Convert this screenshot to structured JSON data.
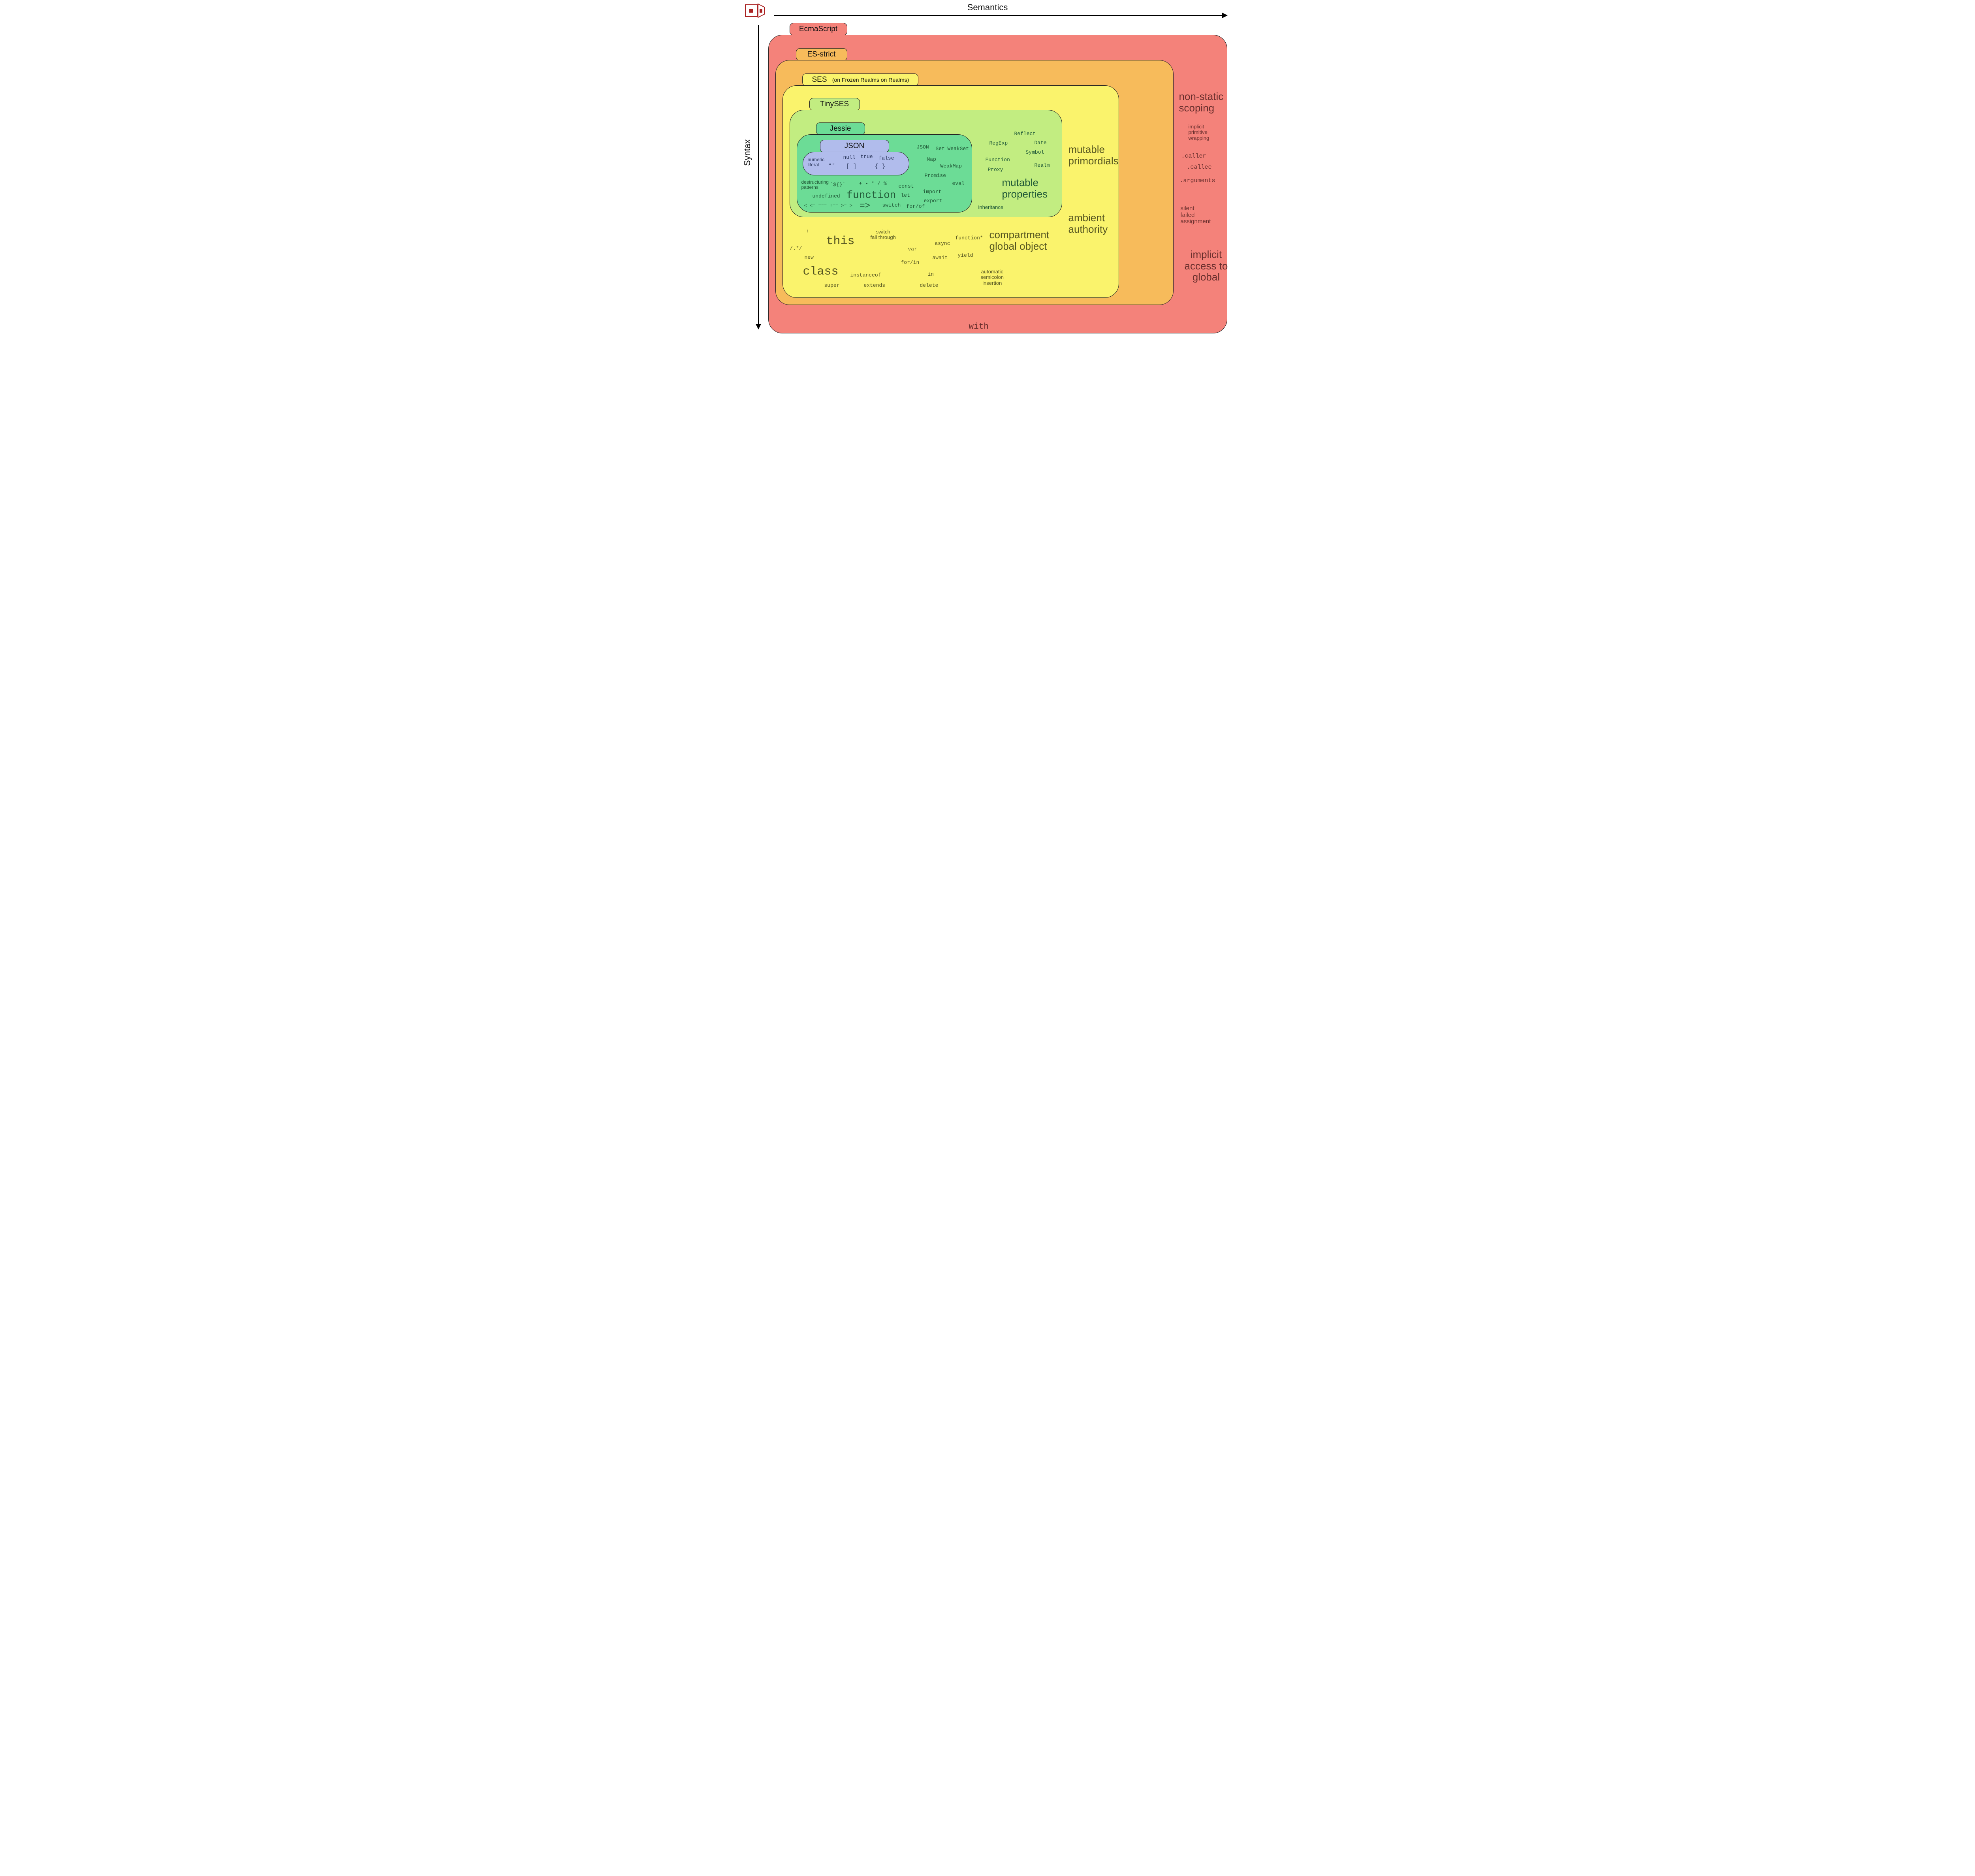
{
  "axes": {
    "x": "Semantics",
    "y": "Syntax"
  },
  "layers": {
    "es": {
      "tab": "EcmaScript"
    },
    "strict": {
      "tab": "ES-strict"
    },
    "ses": {
      "tab": "SES",
      "sub": "(on Frozen Realms on Realms)"
    },
    "tinyses": {
      "tab": "TinySES"
    },
    "jessie": {
      "tab": "Jessie"
    },
    "json": {
      "tab": "JSON"
    }
  },
  "json_items": {
    "numeric_literal": "numeric\nliteral",
    "quotes": "“ ”",
    "null": "null",
    "true": "true",
    "false": "false",
    "array": "[ ]",
    "object": "{ }"
  },
  "jessie_items": {
    "destructuring": "destructuring\npatterns",
    "template_literal": "`${}`",
    "arith": "+ - * / %",
    "undefined": "undefined",
    "function": "function",
    "compare": "< <= === !== >= >",
    "arrow": "=>",
    "switch": "switch",
    "forof": "for/of",
    "const": "const",
    "let": "let",
    "import": "import",
    "export": "export",
    "json_ctor": "JSON",
    "set": "Set",
    "weakset": "WeakSet",
    "map": "Map",
    "weakmap": "WeakMap",
    "promise": "Promise",
    "eval": "eval"
  },
  "tinyses_items": {
    "reflect": "Reflect",
    "regexp": "RegExp",
    "date": "Date",
    "symbol": "Symbol",
    "function_ctor": "Function",
    "realm": "Realm",
    "proxy": "Proxy",
    "mutable_properties": "mutable\nproperties",
    "inheritance": "inheritance"
  },
  "ses_items": {
    "eqeq": "== !=",
    "regex": "/.*/",
    "this": "this",
    "new": "new",
    "class": "class",
    "super": "super",
    "instanceof": "instanceof",
    "extends": "extends",
    "switch_fall": "switch\nfall through",
    "var": "var",
    "forin": "for/in",
    "in": "in",
    "delete": "delete",
    "async": "async",
    "await": "await",
    "function_star": "function*",
    "yield": "yield",
    "asi": "automatic\nsemicolon\ninsertion",
    "cgo": "compartment\nglobal object",
    "mutable_primordials": "mutable\nprimordials",
    "ambient_authority": "ambient\nauthority"
  },
  "es_items": {
    "with": "with",
    "nonstatic": "non-static\nscoping",
    "implicit_primitive": "implicit\nprimitive\nwrapping",
    "caller": ".caller",
    "callee": ".callee",
    "arguments": ".arguments",
    "silent_failed": "silent\nfailed\nassignment",
    "implicit_global": "implicit\naccess to\nglobal"
  }
}
